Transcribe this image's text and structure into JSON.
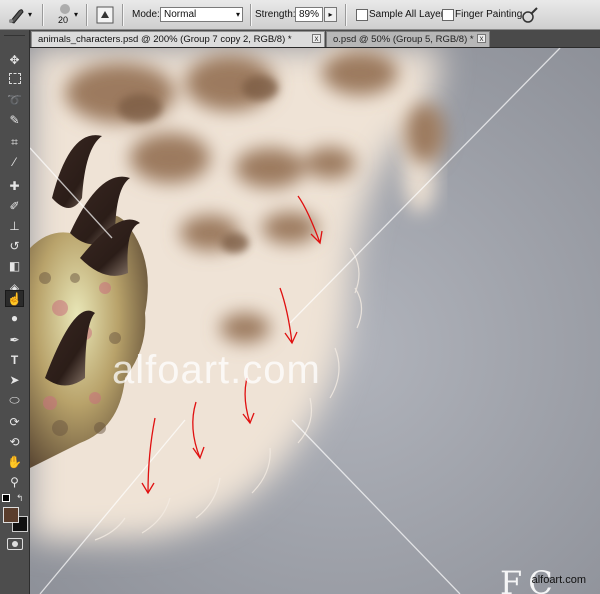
{
  "options": {
    "brush_size": "20",
    "mode_label": "Mode:",
    "mode_value": "Normal",
    "strength_label": "Strength:",
    "strength_value": "89%",
    "sample_all_layers": "Sample All Layers",
    "finger_painting": "Finger Painting"
  },
  "tabs": [
    {
      "label": "animals_characters.psd @ 200% (Group 7 copy 2, RGB/8) *",
      "close": "x"
    },
    {
      "label": "o.psd @ 50% (Group 5, RGB/8) *",
      "close": "x"
    }
  ],
  "canvas": {
    "watermark": "alfoart.com",
    "credit": "alfoart.com",
    "partial_text": "FC"
  },
  "colors": {
    "foreground": "#5a3d2c",
    "background": "#111111",
    "arrow": "#e01010"
  },
  "icons": [
    "smudge-tool-icon",
    "move-icon",
    "marquee-icon",
    "lasso-icon",
    "quick-select-icon",
    "crop-icon",
    "eyedropper-icon",
    "healing-icon",
    "brush-icon",
    "clone-stamp-icon",
    "history-brush-icon",
    "eraser-icon",
    "paint-bucket-icon",
    "smudge-icon",
    "dodge-icon",
    "pen-icon",
    "type-icon",
    "path-select-icon",
    "shape-icon",
    "3d-rotate-icon",
    "3d-orbit-icon",
    "hand-icon",
    "zoom-icon",
    "quick-mask-icon",
    "tablet-pressure-icon"
  ]
}
